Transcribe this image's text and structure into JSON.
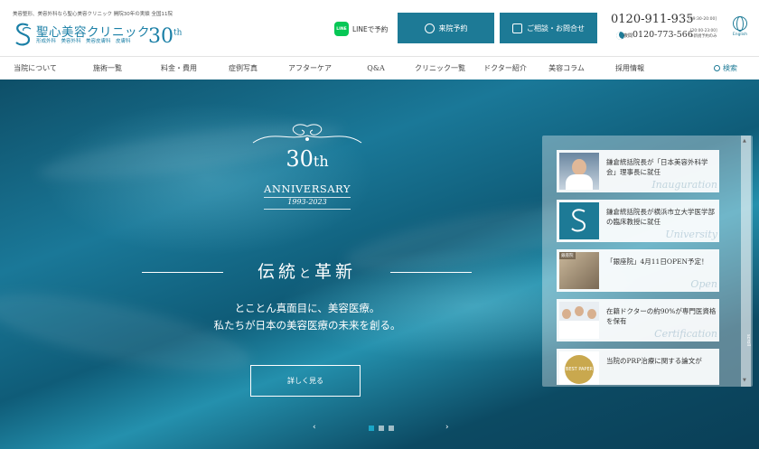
{
  "header": {
    "tagline": "美容整形、美容外科なら聖心美容クリニック 開院30年の実績 全国11院",
    "logo_name": "聖心美容クリニック",
    "logo_sub": "形成外科　美容外科　美容皮膚科　皮膚科",
    "logo_anniv": "30",
    "logo_anniv_suffix": "th",
    "line_label": "LINEで予約",
    "line_icon_text": "LINE",
    "reserve_label": "来院予約",
    "consult_label": "ご相談・お問合せ",
    "phone_main": "0120-911-935",
    "phone_main_hours": "[09:30-20:00]",
    "phone_night_label": "夜間",
    "phone_night": "0120-773-566",
    "phone_night_hours": "[20:00-23:00]",
    "phone_night_note": "※新規予約のみ",
    "english_label": "English"
  },
  "nav": {
    "items": [
      "当院について",
      "施術一覧",
      "料金・費用",
      "症例写真",
      "アフターケア",
      "Q&A",
      "クリニック一覧",
      "ドクター紹介",
      "美容コラム",
      "採用情報"
    ],
    "search_label": "検索"
  },
  "hero": {
    "anniv_number": "30",
    "anniv_suffix": "th",
    "anniv_word": "ANNIVERSARY",
    "anniv_years": "1993-2023",
    "headline_a": "伝統",
    "headline_to": "と",
    "headline_b": "革新",
    "copy_line1": "とことん真面目に、美容医療。",
    "copy_line2": "私たちが日本の美容医療の未来を創る。",
    "more_label": "詳しく見る",
    "prev_arrow": "‹",
    "next_arrow": "›",
    "slide_count": 3,
    "active_slide": 1
  },
  "news": {
    "scroll_label": "scroll",
    "items": [
      {
        "text": "鎌倉統括院長が「日本美容外科学会」理事長に就任",
        "tag": "Inauguration"
      },
      {
        "text": "鎌倉統括院長が横浜市立大学医学部の臨床教授に就任",
        "tag": "University"
      },
      {
        "text": "「銀座院」4月11日OPEN予定！",
        "tag": "Open",
        "badge": "銀座院"
      },
      {
        "text": "在籍ドクターの約90%が専門医資格を保有",
        "tag": "Certification"
      },
      {
        "text": "当院のPRP治療に関する論文が",
        "tag": "",
        "badge": "BEST PAPER"
      }
    ]
  },
  "colors": {
    "brand": "#1d7a96",
    "hero_dark": "#0a3f57",
    "line_green": "#06c755",
    "active_dot": "#1aa6c7"
  }
}
